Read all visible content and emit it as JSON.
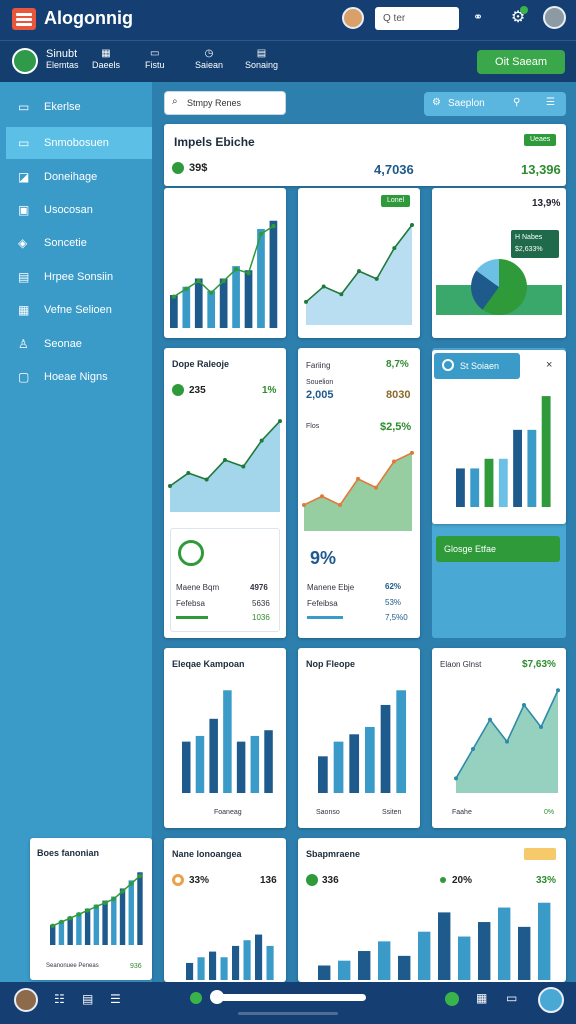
{
  "app": {
    "title": "Alogonnig",
    "search_placeholder": "Q ter"
  },
  "nav": {
    "items": [
      {
        "label1": "Sinubt",
        "label2": "Elemtas"
      },
      {
        "label1": "",
        "label2": "Daeels"
      },
      {
        "label1": "",
        "label2": "Fistu"
      },
      {
        "label1": "",
        "label2": "Saiean"
      },
      {
        "label1": "",
        "label2": "Sonaing"
      }
    ],
    "button": "Oit Saeam"
  },
  "sidebar": {
    "items": [
      {
        "label": "Ekerlse",
        "icon": "doc-icon"
      },
      {
        "label": "Snmobosuen",
        "icon": "card-icon"
      },
      {
        "label": "Doneihage",
        "icon": "tag-icon"
      },
      {
        "label": "Usocosan",
        "icon": "inbox-icon"
      },
      {
        "label": "Soncetie",
        "icon": "shield-icon"
      },
      {
        "label": "Hrpee Sonsiin",
        "icon": "table-icon"
      },
      {
        "label": "Vefne Selioen",
        "icon": "grid-icon"
      },
      {
        "label": "Seonae",
        "icon": "user-icon"
      },
      {
        "label": "Hoeae Nigns",
        "icon": "frame-icon"
      }
    ]
  },
  "toolbar": {
    "search_placeholder": "Stmpy Renes",
    "sapplon": "Saeplon"
  },
  "cards": {
    "c1": {
      "title": "Impels Ebiche",
      "v1": "39$",
      "v2": "4,7036",
      "v3": "13,396",
      "badge": "Ueaes"
    },
    "c2": {
      "badge": "Lonel"
    },
    "c3": {
      "v": "13,9%",
      "badge": "H Nabes\n$2,633%"
    },
    "c4": {
      "title": "Dope Raleoje",
      "v1": "235",
      "v2": "1%",
      "r1l": "Maene Bqm",
      "r1v": "4976",
      "r2l": "Fefebsa",
      "r2v": "5636",
      "r3v": "1036"
    },
    "c5": {
      "title": "Fariing",
      "v0": "8,7%",
      "l1": "Souelion",
      "v1": "2,005",
      "v2": "8030",
      "l2": "Flos",
      "v3": "$2,5%",
      "big": "9%",
      "r1l": "Manene Ebje",
      "r1v": "62%",
      "r2l": "Fefeibsa",
      "r2v": "53%",
      "r3v": "7,5%0"
    },
    "c6": {
      "title": "St Soiaen",
      "close": "×",
      "button": "Glosge Etfae"
    },
    "c7": {
      "title": "Eleqae Kampoan",
      "foot": "Foaneag"
    },
    "c8": {
      "title": "Nop Fleope",
      "foot1": "Saonso",
      "foot2": "Ssiten"
    },
    "c9": {
      "title": "Elaon Glnst",
      "v": "$7,63%",
      "foot1": "Faahe",
      "foot2": "0%"
    },
    "c10": {
      "title": "Boes fanonian",
      "foot1": "Seanonuee Peneas",
      "foot2": "936"
    },
    "c11": {
      "title": "Nane lonoangea",
      "v1": "33%",
      "v2": "136"
    },
    "c12": {
      "title": "Sbapmraene",
      "v1": "336",
      "v2": "20%",
      "v3": "33%"
    }
  },
  "colors": {
    "accent": "#1e5a8c",
    "green": "#2e9a3a",
    "sidebar": "#3a9bc8",
    "topbar": "#153f73"
  },
  "chart_data": [
    {
      "type": "bar",
      "title": "Impels Ebiche",
      "values": [
        8,
        10,
        12,
        9,
        12,
        15,
        14,
        24,
        26
      ],
      "ylim": [
        0,
        30
      ]
    },
    {
      "type": "area",
      "values": [
        3,
        5,
        4,
        7,
        6,
        10,
        13
      ]
    },
    {
      "type": "pie",
      "values": [
        60,
        25,
        15
      ]
    },
    {
      "type": "area",
      "title": "Dope Raleoje",
      "values": [
        4,
        6,
        5,
        8,
        7,
        11,
        14
      ]
    },
    {
      "type": "area",
      "values": [
        3,
        4,
        3,
        6,
        5,
        8,
        9
      ]
    },
    {
      "type": "bar",
      "title": "St Soiaen",
      "values": [
        8,
        8,
        10,
        10,
        16,
        16,
        23
      ]
    },
    {
      "type": "bar",
      "title": "Eleqae Kampoan",
      "values": [
        9,
        10,
        13,
        18,
        9,
        10,
        11
      ]
    },
    {
      "type": "bar",
      "title": "Nop Fleope",
      "values": [
        5,
        7,
        8,
        9,
        12,
        14
      ]
    },
    {
      "type": "area",
      "title": "Elaon Glnst",
      "values": [
        2,
        6,
        10,
        7,
        12,
        9,
        14
      ]
    },
    {
      "type": "bar",
      "title": "Boes fanonian",
      "values": [
        5,
        6,
        7,
        8,
        9,
        10,
        11,
        12,
        14,
        16,
        18
      ]
    },
    {
      "type": "bar",
      "title": "Nane lonoangea",
      "values": [
        3,
        4,
        5,
        4,
        6,
        7,
        8,
        6
      ]
    },
    {
      "type": "bar",
      "title": "Sbapmraene",
      "values": [
        3,
        4,
        6,
        8,
        5,
        10,
        14,
        9,
        12,
        15,
        11,
        16
      ]
    }
  ]
}
